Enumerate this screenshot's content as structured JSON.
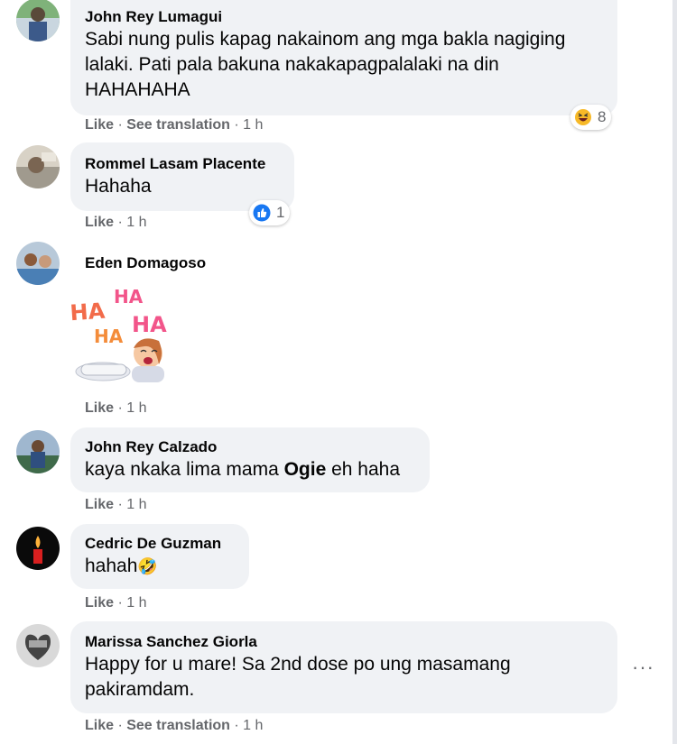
{
  "comments": [
    {
      "author": "John Rey Lumagui",
      "text": "Sabi nung pulis kapag nakainom ang mga bakla nagiging lalaki. Pati pala bakuna nakakapagpalalaki na din HAHAHAHA",
      "like": "Like",
      "see_translation": "See translation",
      "time": "1 h",
      "reaction": {
        "icon": "haha-reaction-icon",
        "count": "8"
      }
    },
    {
      "author": "Rommel Lasam Placente",
      "text": "Hahaha",
      "like": "Like",
      "time": "1 h",
      "reaction": {
        "icon": "like-reaction-icon",
        "count": "1"
      }
    },
    {
      "author": "Eden Domagoso",
      "sticker": {
        "icon": "laughing-sticker-icon",
        "words": [
          "HA",
          "HA",
          "HA",
          "HA"
        ]
      },
      "like": "Like",
      "time": "1 h"
    },
    {
      "author": "John Rey Calzado",
      "text_before": "kaya nkaka lima mama ",
      "text_mention": "Ogie",
      "text_after": " eh haha",
      "like": "Like",
      "time": "1 h"
    },
    {
      "author": "Cedric De Guzman",
      "text": "hahah",
      "emoji": "🤣",
      "like": "Like",
      "time": "1 h"
    },
    {
      "author": "Marissa Sanchez Giorla",
      "text": "Happy for u mare! Sa 2nd dose po ung masamang pakiramdam.",
      "like": "Like",
      "see_translation": "See translation",
      "time": "1 h",
      "more": "···"
    }
  ],
  "separator": " · ",
  "colors": {
    "bubble": "#f0f2f5",
    "meta": "#65676b",
    "like_blue": "#1877f2",
    "haha_yellow": "#f7b928"
  }
}
